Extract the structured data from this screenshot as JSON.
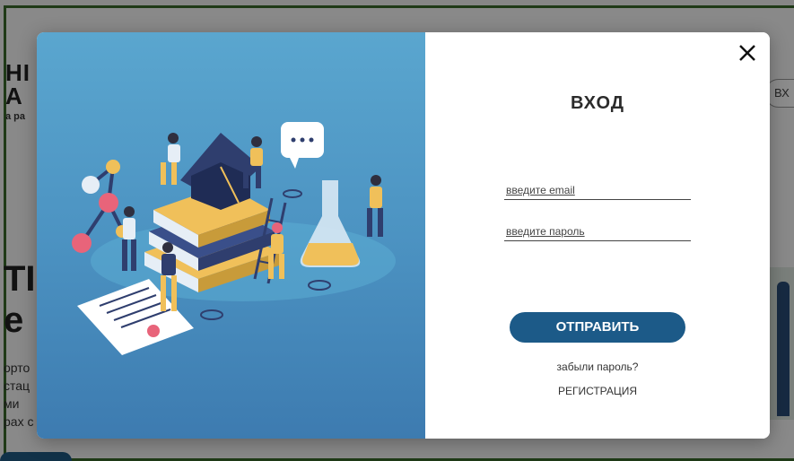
{
  "background": {
    "logo_line1": "НІ",
    "logo_line2": "А",
    "logo_sub": "а ра",
    "login_label": "ВХ",
    "hero_title_line1": "ТІ",
    "hero_title_line2": "е",
    "hero_text_lines": [
      "орто",
      "стац",
      "ми",
      "рах с"
    ]
  },
  "modal": {
    "title": "ВХОД",
    "email_placeholder": "введите email",
    "password_placeholder": "введите пароль",
    "submit_label": "ОТПРАВИТЬ",
    "forgot_label": "забыли пароль?",
    "register_label": "РЕГИСТРАЦИЯ",
    "close_icon": "close-icon"
  },
  "colors": {
    "accent": "#1c5a88",
    "illustration_bg": "#4c93c2",
    "frame_border": "#3a6a2a"
  }
}
